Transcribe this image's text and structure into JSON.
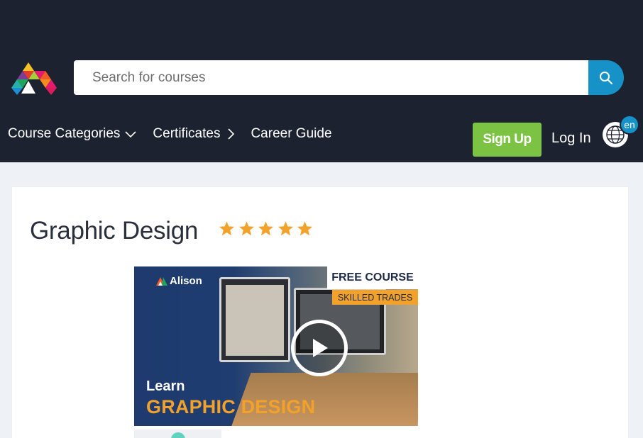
{
  "header": {
    "logo_icon": "alison-logo-icon",
    "search": {
      "placeholder": "Search for courses",
      "button_icon": "search-icon"
    },
    "nav": [
      {
        "label": "Course Categories",
        "icon": "chevron-down-icon"
      },
      {
        "label": "Certificates",
        "icon": "chevron-right-icon"
      },
      {
        "label": "Career Guide"
      }
    ],
    "signup_label": "Sign Up",
    "login_label": "Log In",
    "language": {
      "icon": "globe-icon",
      "code": "en"
    }
  },
  "course": {
    "title": "Graphic Design",
    "rating_stars": 5,
    "star_color": "#f2a22b",
    "thumbnail": {
      "brand": "Alison",
      "badge_top": "FREE COURSE",
      "badge_bottom": "SKILLED TRADES",
      "line1": "Learn",
      "line2": "GRAPHIC DESIGN",
      "play_icon": "play-icon"
    }
  },
  "colors": {
    "header_bg": "#1c2230",
    "accent_blue": "#1692c8",
    "signup_green": "#7cc243",
    "page_bg": "#eef2f7"
  }
}
